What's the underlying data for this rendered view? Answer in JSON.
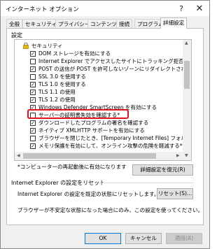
{
  "window": {
    "title": "インターネット オプション",
    "help_glyph": "?",
    "close_glyph": "✕"
  },
  "tabs": [
    {
      "label": "全般",
      "active": false
    },
    {
      "label": "セキュリティ",
      "active": false
    },
    {
      "label": "プライバシー",
      "active": false
    },
    {
      "label": "コンテンツ",
      "active": false
    },
    {
      "label": "接続",
      "active": false
    },
    {
      "label": "プログラム",
      "active": false
    },
    {
      "label": "詳細設定",
      "active": true
    }
  ],
  "settings": {
    "group_label": "設定",
    "category": {
      "label": "セキュリティ",
      "icon": "lock-icon"
    },
    "items": [
      {
        "label": "DOM ストレージを有効にする",
        "checked": true
      },
      {
        "label": "Internet Explorer でアクセスしたサイトにトラッキング拒否要求を送信す",
        "checked": false
      },
      {
        "label": "POST の送信が POST を許可しないゾーンにリダイレクトされた場合に警",
        "checked": true
      },
      {
        "label": "SSL 3.0 を使用する",
        "checked": false
      },
      {
        "label": "TLS 1.0 を使用する",
        "checked": true
      },
      {
        "label": "TLS 1.1 の使用",
        "checked": true
      },
      {
        "label": "TLS 1.2 の使用",
        "checked": true
      },
      {
        "label": "Windows Defender SmartScreen を有効にする",
        "checked": true
      },
      {
        "label": "サーバーの証明書失効を確認する*",
        "checked": false,
        "highlighted": true
      },
      {
        "label": "ダウンロードしたプログラムの署名を確認する",
        "checked": true
      },
      {
        "label": "ネイティブ XMLHTTP サポートを有効にする",
        "checked": true
      },
      {
        "label": "ブラウザーを閉じたとき、[Temporary Internet Files] フォルダーを空にす",
        "checked": false
      },
      {
        "label": "メモリ保護を有効にして、オンライン攻撃の危険を軽減する*",
        "checked": true
      }
    ],
    "note": "*コンピューターの再起動後に有効になります",
    "restore_button": "詳細設定を復元(R)"
  },
  "reset": {
    "group_label": "Internet Explorer の設定をリセット",
    "description": "Internet Explorer の設定を既定の状態にリセットします。",
    "reset_button": "リセット(S)...",
    "warning": "ブラウザーが不安定な状態になった場合にのみ、この設定を使ってください。"
  },
  "footer": {
    "ok": "OK",
    "cancel": "キャンセル",
    "apply": "適用(A)"
  },
  "colors": {
    "highlight_border": "#e0141e",
    "default_button_border": "#0078d7"
  }
}
